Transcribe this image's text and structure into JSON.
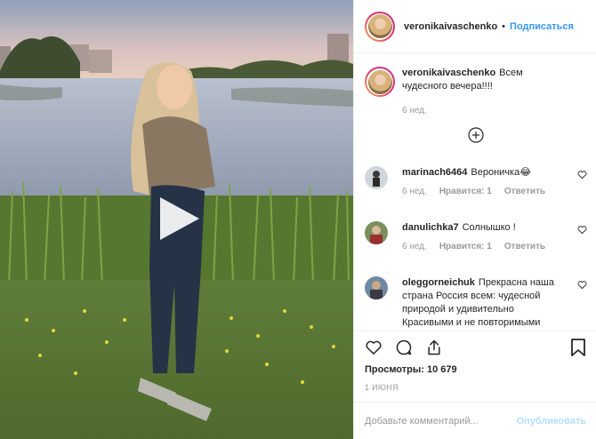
{
  "post": {
    "username": "veronikaivaschenko",
    "follow_label": "Подписаться",
    "separator": "•",
    "caption": "Всем чудесного вечера!!!!",
    "caption_age": "6 нед.",
    "views_label": "Просмотры:",
    "views_count": "10 679",
    "date": "1 ИЮНЯ",
    "comment_placeholder": "Добавьте комментарий...",
    "publish_label": "Опубликовать"
  },
  "comments": [
    {
      "username": "marinach6464",
      "text": "Вероничка😂",
      "age": "6 нед.",
      "likes": "Нравится: 1",
      "reply": "Ответить"
    },
    {
      "username": "danulichka7",
      "text": "Солнышко !",
      "age": "6 нед.",
      "likes": "Нравится: 1",
      "reply": "Ответить"
    },
    {
      "username": "oleggorneichuk",
      "text": "Прекрасна наша страна Россия всем: чудесной природой и удивительно Красивыми и не повторимыми"
    }
  ],
  "icons": {
    "play": "play-icon",
    "load_more": "plus-circle-icon",
    "like": "heart-icon",
    "comment": "comment-icon",
    "share": "share-icon",
    "save": "bookmark-icon"
  },
  "colors": {
    "link": "#3897f0",
    "publish_disabled": "#b2dffc",
    "muted": "#999999"
  }
}
